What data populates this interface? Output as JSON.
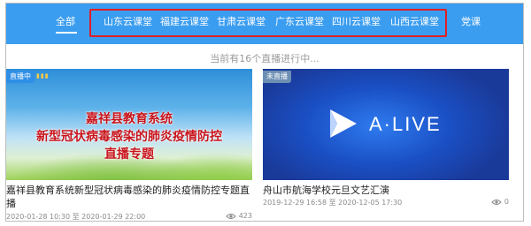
{
  "nav": {
    "all": "全部",
    "regions": [
      "山东云课堂",
      "福建云课堂",
      "甘肃云课堂",
      "广东云课堂",
      "四川云课堂",
      "山西云课堂"
    ],
    "party": "党课"
  },
  "subtitle": "当前有16个直播进行中...",
  "cards": [
    {
      "badge": "直播中",
      "poster_lines": [
        "嘉祥县教育系统",
        "新型冠状病毒感染的肺炎疫情防控",
        "直播专题"
      ],
      "title": "嘉祥县教育系统新型冠状病毒感染的肺炎疫情防控专题直播",
      "date_range": "2020-01-28 10:30 至 2020-01-29 22:00",
      "views": "423"
    },
    {
      "badge": "未直播",
      "poster_text": "A·LIVE",
      "title": "舟山市航海学校元旦文艺汇演",
      "date_range": "2019-12-29 16:58 至 2020-12-05 17:30",
      "views": "0"
    }
  ],
  "colors": {
    "nav_bg": "#3b9df0",
    "highlight_border": "#e01f26",
    "poster_red": "#c8141b"
  }
}
